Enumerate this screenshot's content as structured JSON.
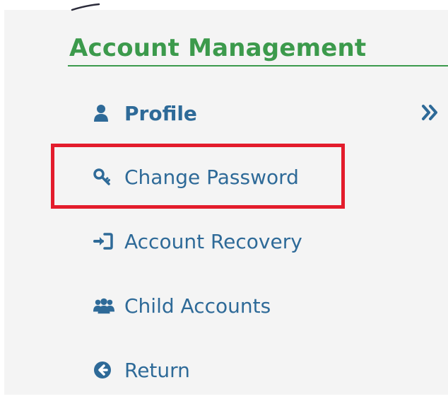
{
  "sidebar": {
    "title": "Account Management",
    "items": [
      {
        "label": "Profile",
        "icon": "user-icon",
        "active": true
      },
      {
        "label": "Change Password",
        "icon": "key-icon",
        "highlighted": true
      },
      {
        "label": "Account Recovery",
        "icon": "sign-in-icon"
      },
      {
        "label": "Child Accounts",
        "icon": "users-icon"
      },
      {
        "label": "Return",
        "icon": "arrow-circle-left-icon"
      }
    ]
  },
  "colors": {
    "title_green": "#3c9a4c",
    "link_blue": "#2e6a98",
    "highlight_red": "#e31c2c",
    "panel_bg": "#f4f4f4"
  }
}
